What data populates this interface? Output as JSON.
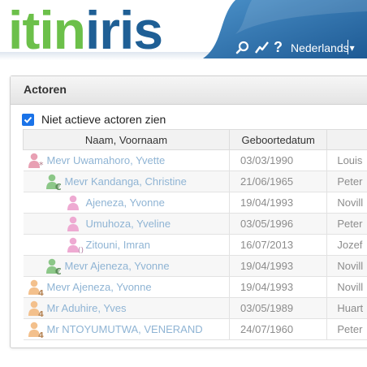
{
  "header": {
    "logo_part1": "itin",
    "logo_part2": "iris",
    "help": "?",
    "language": "Nederlands",
    "language_arrow": "▾",
    "icons": [
      "search-icon",
      "analytics-icon"
    ]
  },
  "panel": {
    "title": "Actoren",
    "checkbox_label": "Niet actieve actoren zien",
    "checkbox_checked": true
  },
  "table": {
    "columns": [
      "Naam, Voornaam",
      "Geboortedatum",
      ""
    ],
    "rows": [
      {
        "name": "Mevr Uwamahoro, Yvette",
        "date": "03/03/1990",
        "extra": "Louis",
        "icon": "person-pink-star-icon",
        "indent": 0
      },
      {
        "name": "Mevr Kandanga, Christine",
        "date": "21/06/1965",
        "extra": "Peter",
        "icon": "person-green-euro-icon",
        "indent": 1
      },
      {
        "name": "Ajeneza, Yvonne",
        "date": "19/04/1993",
        "extra": "Novill",
        "icon": "person-pink-icon",
        "indent": 2
      },
      {
        "name": "Umuhoza, Yveline",
        "date": "03/05/1996",
        "extra": "Peter",
        "icon": "person-pink-icon",
        "indent": 2
      },
      {
        "name": "Zitouni, Imran",
        "date": "16/07/2013",
        "extra": "Jozef",
        "icon": "person-pink-paren-icon",
        "indent": 2
      },
      {
        "name": "Mevr Ajeneza, Yvonne",
        "date": "19/04/1993",
        "extra": "Novill",
        "icon": "person-green-euro-icon",
        "indent": 1
      },
      {
        "name": "Mevr Ajeneza, Yvonne",
        "date": "19/04/1993",
        "extra": "Novill",
        "icon": "person-orange-4-icon",
        "indent": 0
      },
      {
        "name": "Mr Aduhire, Yves",
        "date": "03/05/1989",
        "extra": "Huart",
        "icon": "person-orange-4-icon",
        "indent": 0
      },
      {
        "name": "Mr NTOYUMUTWA, VENERAND",
        "date": "24/07/1960",
        "extra": "Peter",
        "icon": "person-orange-4-icon",
        "indent": 0
      }
    ]
  },
  "colors": {
    "logo_green": "#6cc04a",
    "logo_blue": "#1f5f95",
    "header_blue": "#2a6fae",
    "checkbox_blue": "#1a73e8",
    "name_link": "#8fb4d4",
    "muted_text": "#8c8c8c"
  }
}
